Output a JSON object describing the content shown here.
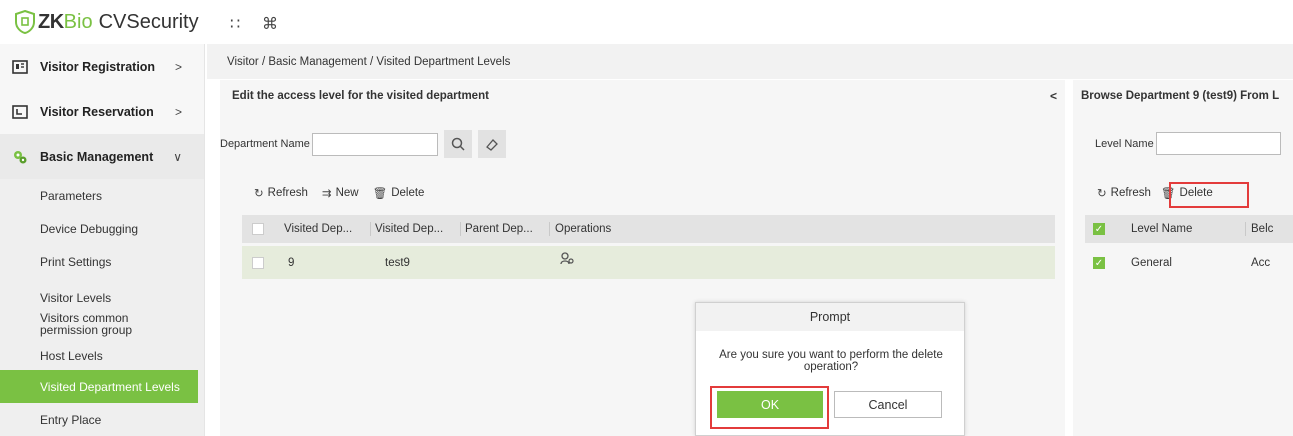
{
  "app": {
    "brand_zk": "ZK",
    "brand_bio": "Bio",
    "brand_cv": "CVSecurity",
    "accent": "#7ac143",
    "highlight": "#e33b3b"
  },
  "topbar": {
    "icons": [
      "grid-icon",
      "command-icon"
    ],
    "grid_glyph": "∷",
    "command_glyph": "⌘"
  },
  "sidebar": {
    "menus": [
      {
        "label": "Visitor Registration",
        "chevron": ">"
      },
      {
        "label": "Visitor Reservation",
        "chevron": ">"
      },
      {
        "label": "Basic Management",
        "chevron": "∨"
      }
    ],
    "sub_items": [
      "Parameters",
      "Device Debugging",
      "Print Settings",
      "Visitor Levels",
      "Visitors common permission group",
      "Host Levels",
      "Visited Department Levels",
      "Entry Place"
    ],
    "selected": "Visited Department Levels"
  },
  "breadcrumb": "Visitor / Basic Management / Visited Department Levels",
  "left_panel": {
    "title": "Edit the access level for the visited department",
    "filter_label": "Department Name",
    "filter_value": "",
    "toolbar": {
      "refresh": "Refresh",
      "new": "New",
      "delete": "Delete"
    },
    "columns": [
      "Visited Dep...",
      "Visited Dep...",
      "Parent Dep...",
      "Operations"
    ],
    "rows": [
      {
        "number": "9",
        "name": "test9",
        "parent": ""
      }
    ]
  },
  "right_panel": {
    "title": "Browse Department 9 (test9)  From L",
    "filter_label": "Level Name",
    "toolbar": {
      "refresh": "Refresh",
      "delete": "Delete"
    },
    "columns": [
      "Level Name",
      "Belc"
    ],
    "rows": [
      {
        "level": "General",
        "belongs": "Acc"
      }
    ]
  },
  "dialog": {
    "title": "Prompt",
    "message": "Are you sure you want to perform the delete operation?",
    "ok": "OK",
    "cancel": "Cancel"
  }
}
